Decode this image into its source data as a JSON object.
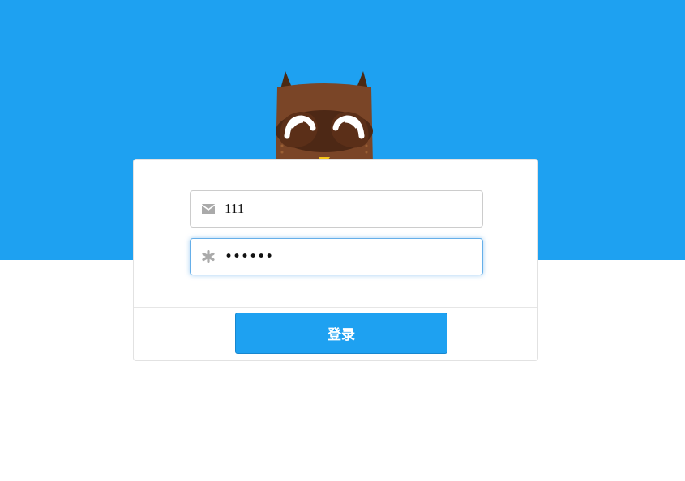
{
  "login": {
    "email_value": "111",
    "password_value": "111111",
    "submit_label": "登录"
  },
  "colors": {
    "brand_blue": "#1ea1f1",
    "focus_border": "#66afe9"
  },
  "icons": {
    "email": "envelope-icon",
    "password": "asterisk-icon",
    "mascot": "owl-mascot"
  }
}
